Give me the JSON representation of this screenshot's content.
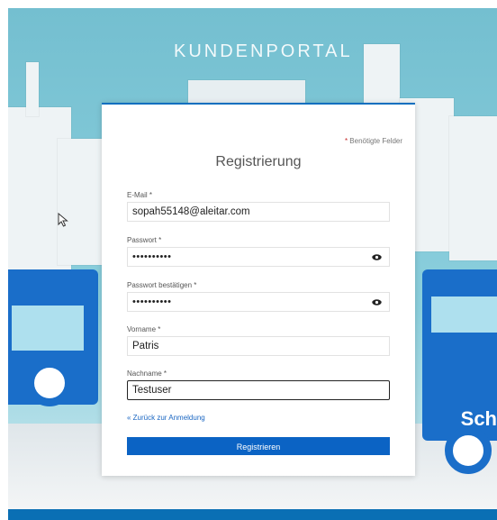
{
  "header": {
    "portal_title": "KUNDENPORTAL",
    "bus_text": "Sch"
  },
  "form": {
    "required_note": "Benötigte Felder",
    "title": "Registrierung",
    "fields": {
      "email": {
        "label": "E-Mail *",
        "value": "sopah55148@aleitar.com"
      },
      "password": {
        "label": "Passwort *",
        "value": "••••••••••"
      },
      "password_confirm": {
        "label": "Passwort bestätigen *",
        "value": "••••••••••"
      },
      "firstname": {
        "label": "Vorname *",
        "value": "Patris"
      },
      "lastname": {
        "label": "Nachname *",
        "value": "Testuser"
      }
    },
    "back_link": "« Zurück zur Anmeldung",
    "submit_label": "Registrieren"
  },
  "colors": {
    "accent": "#0b63c4",
    "required": "#c62828",
    "sky": "#7fc6d6",
    "bus": "#1a6ec9"
  },
  "icons": {
    "password_toggle": "eye-icon"
  }
}
